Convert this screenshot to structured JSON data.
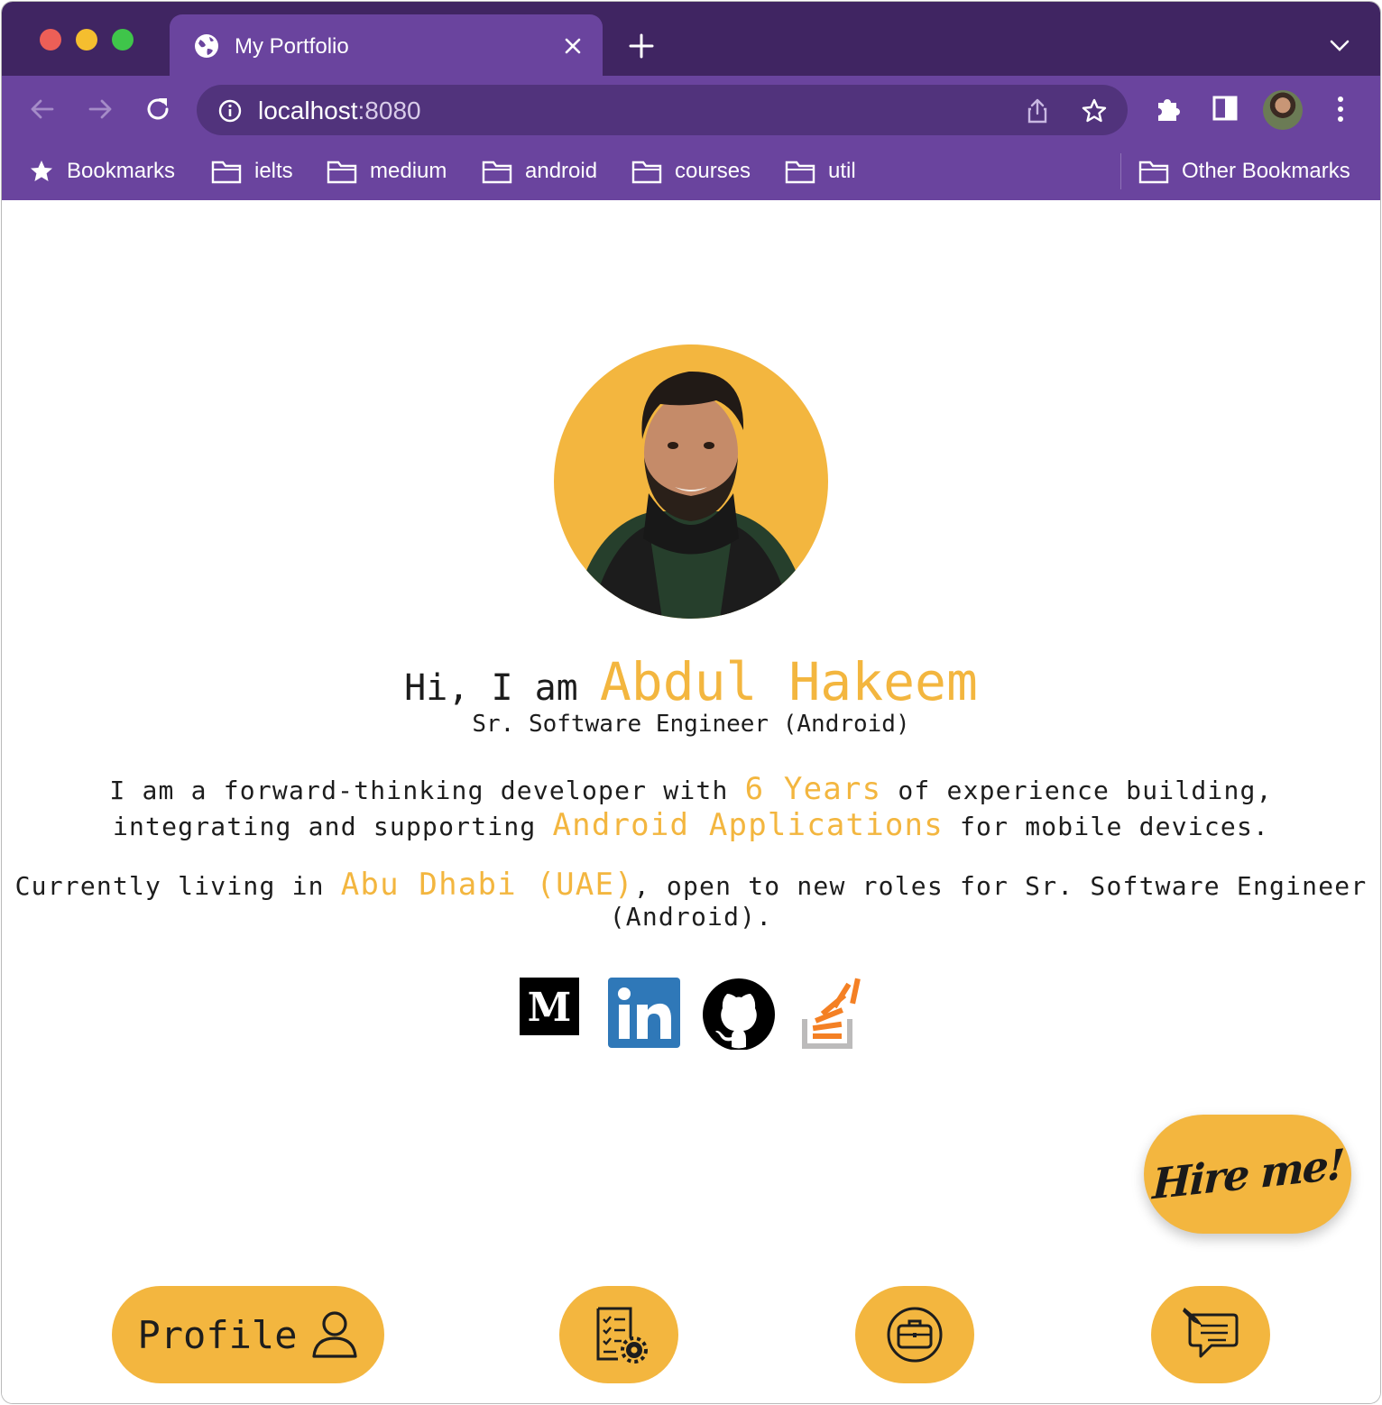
{
  "browser": {
    "tab_title": "My Portfolio",
    "url_host": "localhost",
    "url_port": ":8080",
    "bookmarks_label": "Bookmarks",
    "bookmark_folders": [
      "ielts",
      "medium",
      "android",
      "courses",
      "util"
    ],
    "other_bookmarks": "Other Bookmarks",
    "traffic_lights": [
      "#ed5f57",
      "#f5be2f",
      "#3fc54a"
    ],
    "frame_color": "#402562",
    "toolbar_color": "#6a449e"
  },
  "profile": {
    "greeting": "Hi, I am ",
    "name": "Abdul Hakeem",
    "role": "Sr. Software Engineer (Android)",
    "intro_1": "I am a forward-thinking developer with ",
    "years": "6 Years",
    "intro_2": " of experience building, integrating and supporting ",
    "apps": "Android Applications",
    "intro_3": " for mobile devices.",
    "location_1": "Currently living in ",
    "location": "Abu Dhabi (UAE)",
    "location_2": ", open to new roles for Sr. Software Engineer (Android).",
    "accent_color": "#f3b63f"
  },
  "social": [
    "medium-icon",
    "linkedin-icon",
    "github-icon",
    "stackoverflow-icon"
  ],
  "cta": {
    "hire_label": "Hire me!"
  },
  "bottom_nav": {
    "profile_label": "Profile",
    "items": [
      "profile-icon",
      "resume-icon",
      "portfolio-icon",
      "contact-icon"
    ]
  }
}
